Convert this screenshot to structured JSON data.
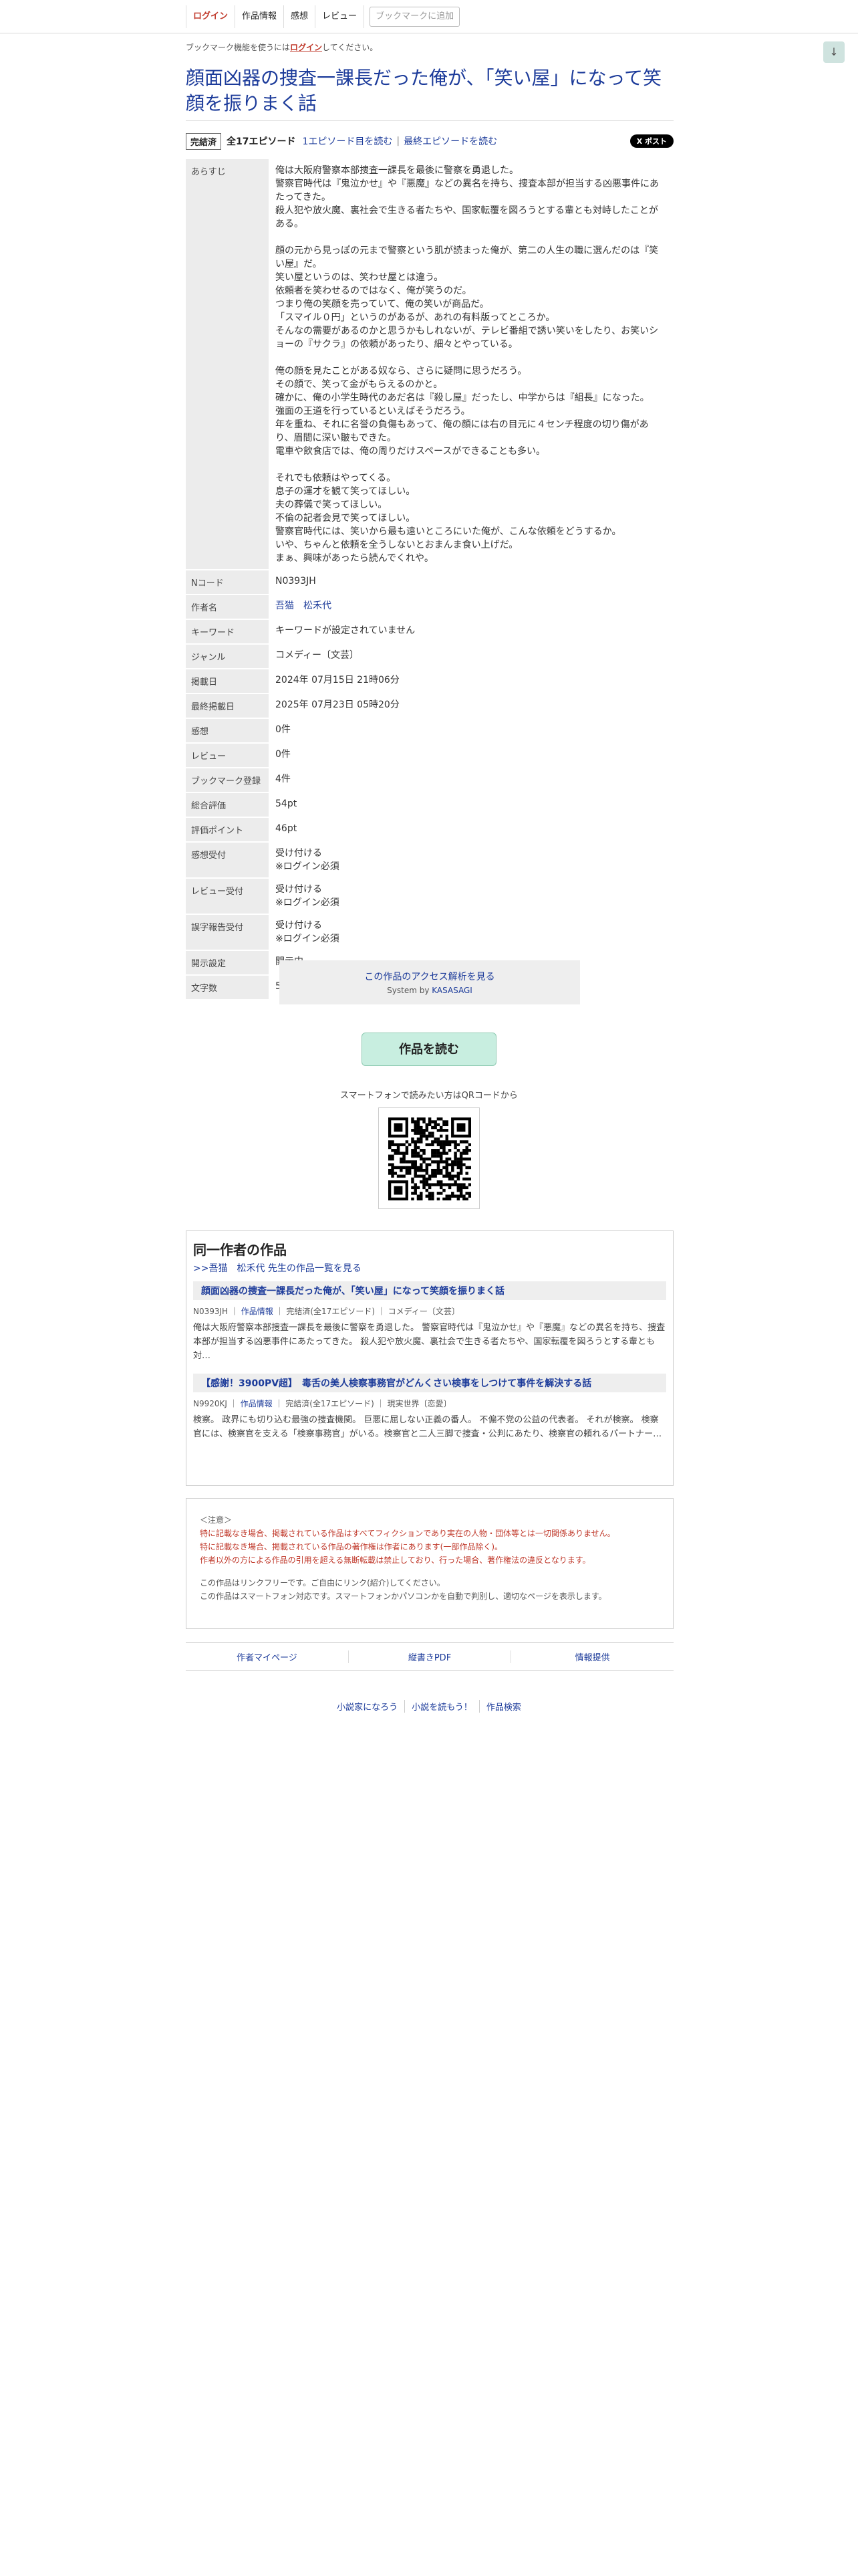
{
  "nav": {
    "login": "ログイン",
    "work_info": "作品情報",
    "impressions": "感想",
    "review": "レビュー",
    "add_bookmark": "ブックマークに追加"
  },
  "scroll_glyph": "↓",
  "login_note": {
    "prefix": "ブックマーク機能を使うには",
    "link": "ログイン",
    "suffix": "してください。"
  },
  "title": "顔面凶器の捜査一課長だった俺が、「笑い屋」になって笑顔を振りまく話",
  "episodes": {
    "status": "完結済",
    "count": "全17エピソード",
    "first_link": "1エピソード目を読む",
    "sep": "|",
    "last_link": "最終エピソードを読む",
    "xpost": "X ポスト"
  },
  "info": {
    "synopsis_label": "あらすじ",
    "synopsis": [
      "俺は大阪府警察本部捜査一課長を最後に警察を勇退した。\n警察官時代は『鬼泣かせ』や『悪魔』などの異名を持ち、捜査本部が担当する凶悪事件にあたってきた。\n殺人犯や放火魔、裏社会で生きる者たちや、国家転覆を図ろうとする輩とも対峙したことがある。",
      "顔の元から見っぽの元まで警察という肌が読まった俺が、第二の人生の職に選んだのは『笑い屋』だ。\n笑い屋というのは、笑わせ屋とは違う。\n依頼者を笑わせるのではなく、俺が笑うのだ。\nつまり俺の笑顔を売っていて、俺の笑いが商品だ。\n「スマイル０円」というのがあるが、あれの有料版ってところか。\nそんなの需要があるのかと思うかもしれないが、テレビ番組で誘い笑いをしたり、お笑いショーの『サクラ』の依頼があったり、細々とやっている。",
      "俺の顔を見たことがある奴なら、さらに疑問に思うだろう。\nその顔で、笑って金がもらえるのかと。\n確かに、俺の小学生時代のあだ名は『殺し屋』だったし、中学からは『組長』になった。\n強面の王道を行っているといえばそうだろう。\n年を重ね、それに名誉の負傷もあって、俺の顔には右の目元に４センチ程度の切り傷があり、眉間に深い皺もできた。\n電車や飲食店では、俺の周りだけスペースができることも多い。",
      "それでも依頼はやってくる。\n息子の運才を観て笑ってほしい。\n夫の葬儀で笑ってほしい。\n不倫の記者会見で笑ってほしい。\n警察官時代には、笑いから最も遠いところにいた俺が、こんな依頼をどうするか。\nいや、ちゃんと依頼を全うしないとおまんま食い上げだ。\nまぁ、興味があったら読んでくれや。"
    ],
    "rows": [
      {
        "label": "Nコード",
        "value": "N0393JH"
      },
      {
        "label": "作者名",
        "value": "吾猫　松禾代",
        "link": true
      },
      {
        "label": "キーワード",
        "value": "キーワードが設定されていません"
      },
      {
        "label": "ジャンル",
        "value": "コメディー〔文芸〕"
      },
      {
        "label": "掲載日",
        "value": "2024年 07月15日 21時06分"
      },
      {
        "label": "最終掲載日",
        "value": "2025年 07月23日 05時20分"
      },
      {
        "label": "感想",
        "value": "0件"
      },
      {
        "label": "レビュー",
        "value": "0件"
      },
      {
        "label": "ブックマーク登録",
        "value": "4件"
      },
      {
        "label": "総合評価",
        "value": "54pt"
      },
      {
        "label": "評価ポイント",
        "value": "46pt"
      },
      {
        "label": "感想受付",
        "value": "受け付ける",
        "sub": "※ログイン必須"
      },
      {
        "label": "レビュー受付",
        "value": "受け付ける",
        "sub": "※ログイン必須"
      },
      {
        "label": "誤字報告受付",
        "value": "受け付ける",
        "sub": "※ログイン必須"
      },
      {
        "label": "開示設定",
        "value": "開示中"
      },
      {
        "label": "文字数",
        "value": "50,001文字"
      }
    ]
  },
  "access": {
    "link": "この作品のアクセス解析を見る",
    "system_prefix": "System by ",
    "system_name": "KASASAGI"
  },
  "read_button": "作品を読む",
  "qr_caption": "スマートフォンで読みたい方はQRコードから",
  "same_author": {
    "heading": "同一作者の作品",
    "more_link": ">>吾猫　松禾代 先生の作品一覧を見る",
    "works": [
      {
        "title": "顔面凶器の捜査一課長だった俺が、「笑い屋」になって笑顔を振りまく話",
        "ncode": "N0393JH",
        "info_link": "作品情報",
        "status": "完結済(全17エピソード)",
        "genre": "コメディー〔文芸〕",
        "desc": "俺は大阪府警察本部捜査一課長を最後に警察を勇退した。 警察官時代は『鬼泣かせ』や『悪魔』などの異名を持ち、捜査本部が担当する凶悪事件にあたってきた。 殺人犯や放火魔、裏社会で生きる者たちや、国家転覆を図ろうとする輩とも対…"
      },
      {
        "title": "【感謝！3900PV超】　毒舌の美人検察事務官がどんくさい検事をしつけて事件を解決する話",
        "ncode": "N9920KJ",
        "info_link": "作品情報",
        "status": "完結済(全17エピソード)",
        "genre": "現実世界〔恋愛〕",
        "desc": "検察。 政界にも切り込む最強の捜査機関。 巨悪に屈しない正義の番人。 不偏不党の公益の代表者。 それが検察。 検察官には、検察官を支える「検察事務官」がいる。検察官と二人三脚で捜査・公判にあたり、検察官の頼れるパートナー…"
      }
    ]
  },
  "notice": {
    "head": "＜注意＞",
    "red_lines": [
      "特に記載なき場合、掲載されている作品はすべてフィクションであり実在の人物・団体等とは一切関係ありません。",
      "特に記載なき場合、掲載されている作品の著作権は作者にあります(一部作品除く)。",
      "作者以外の方による作品の引用を超える無断転載は禁止しており、行った場合、著作権法の違反となります。"
    ],
    "gray_lines": [
      "この作品はリンクフリーです。ご自由にリンク(紹介)してください。",
      "この作品はスマートフォン対応です。スマートフォンかパソコンかを自動で判別し、適切なページを表示します。"
    ]
  },
  "footer_links": [
    "作者マイページ",
    "縦書きPDF",
    "情報提供"
  ],
  "site_links": [
    "小説家になろう",
    "小説を読もう！",
    "作品検索"
  ]
}
